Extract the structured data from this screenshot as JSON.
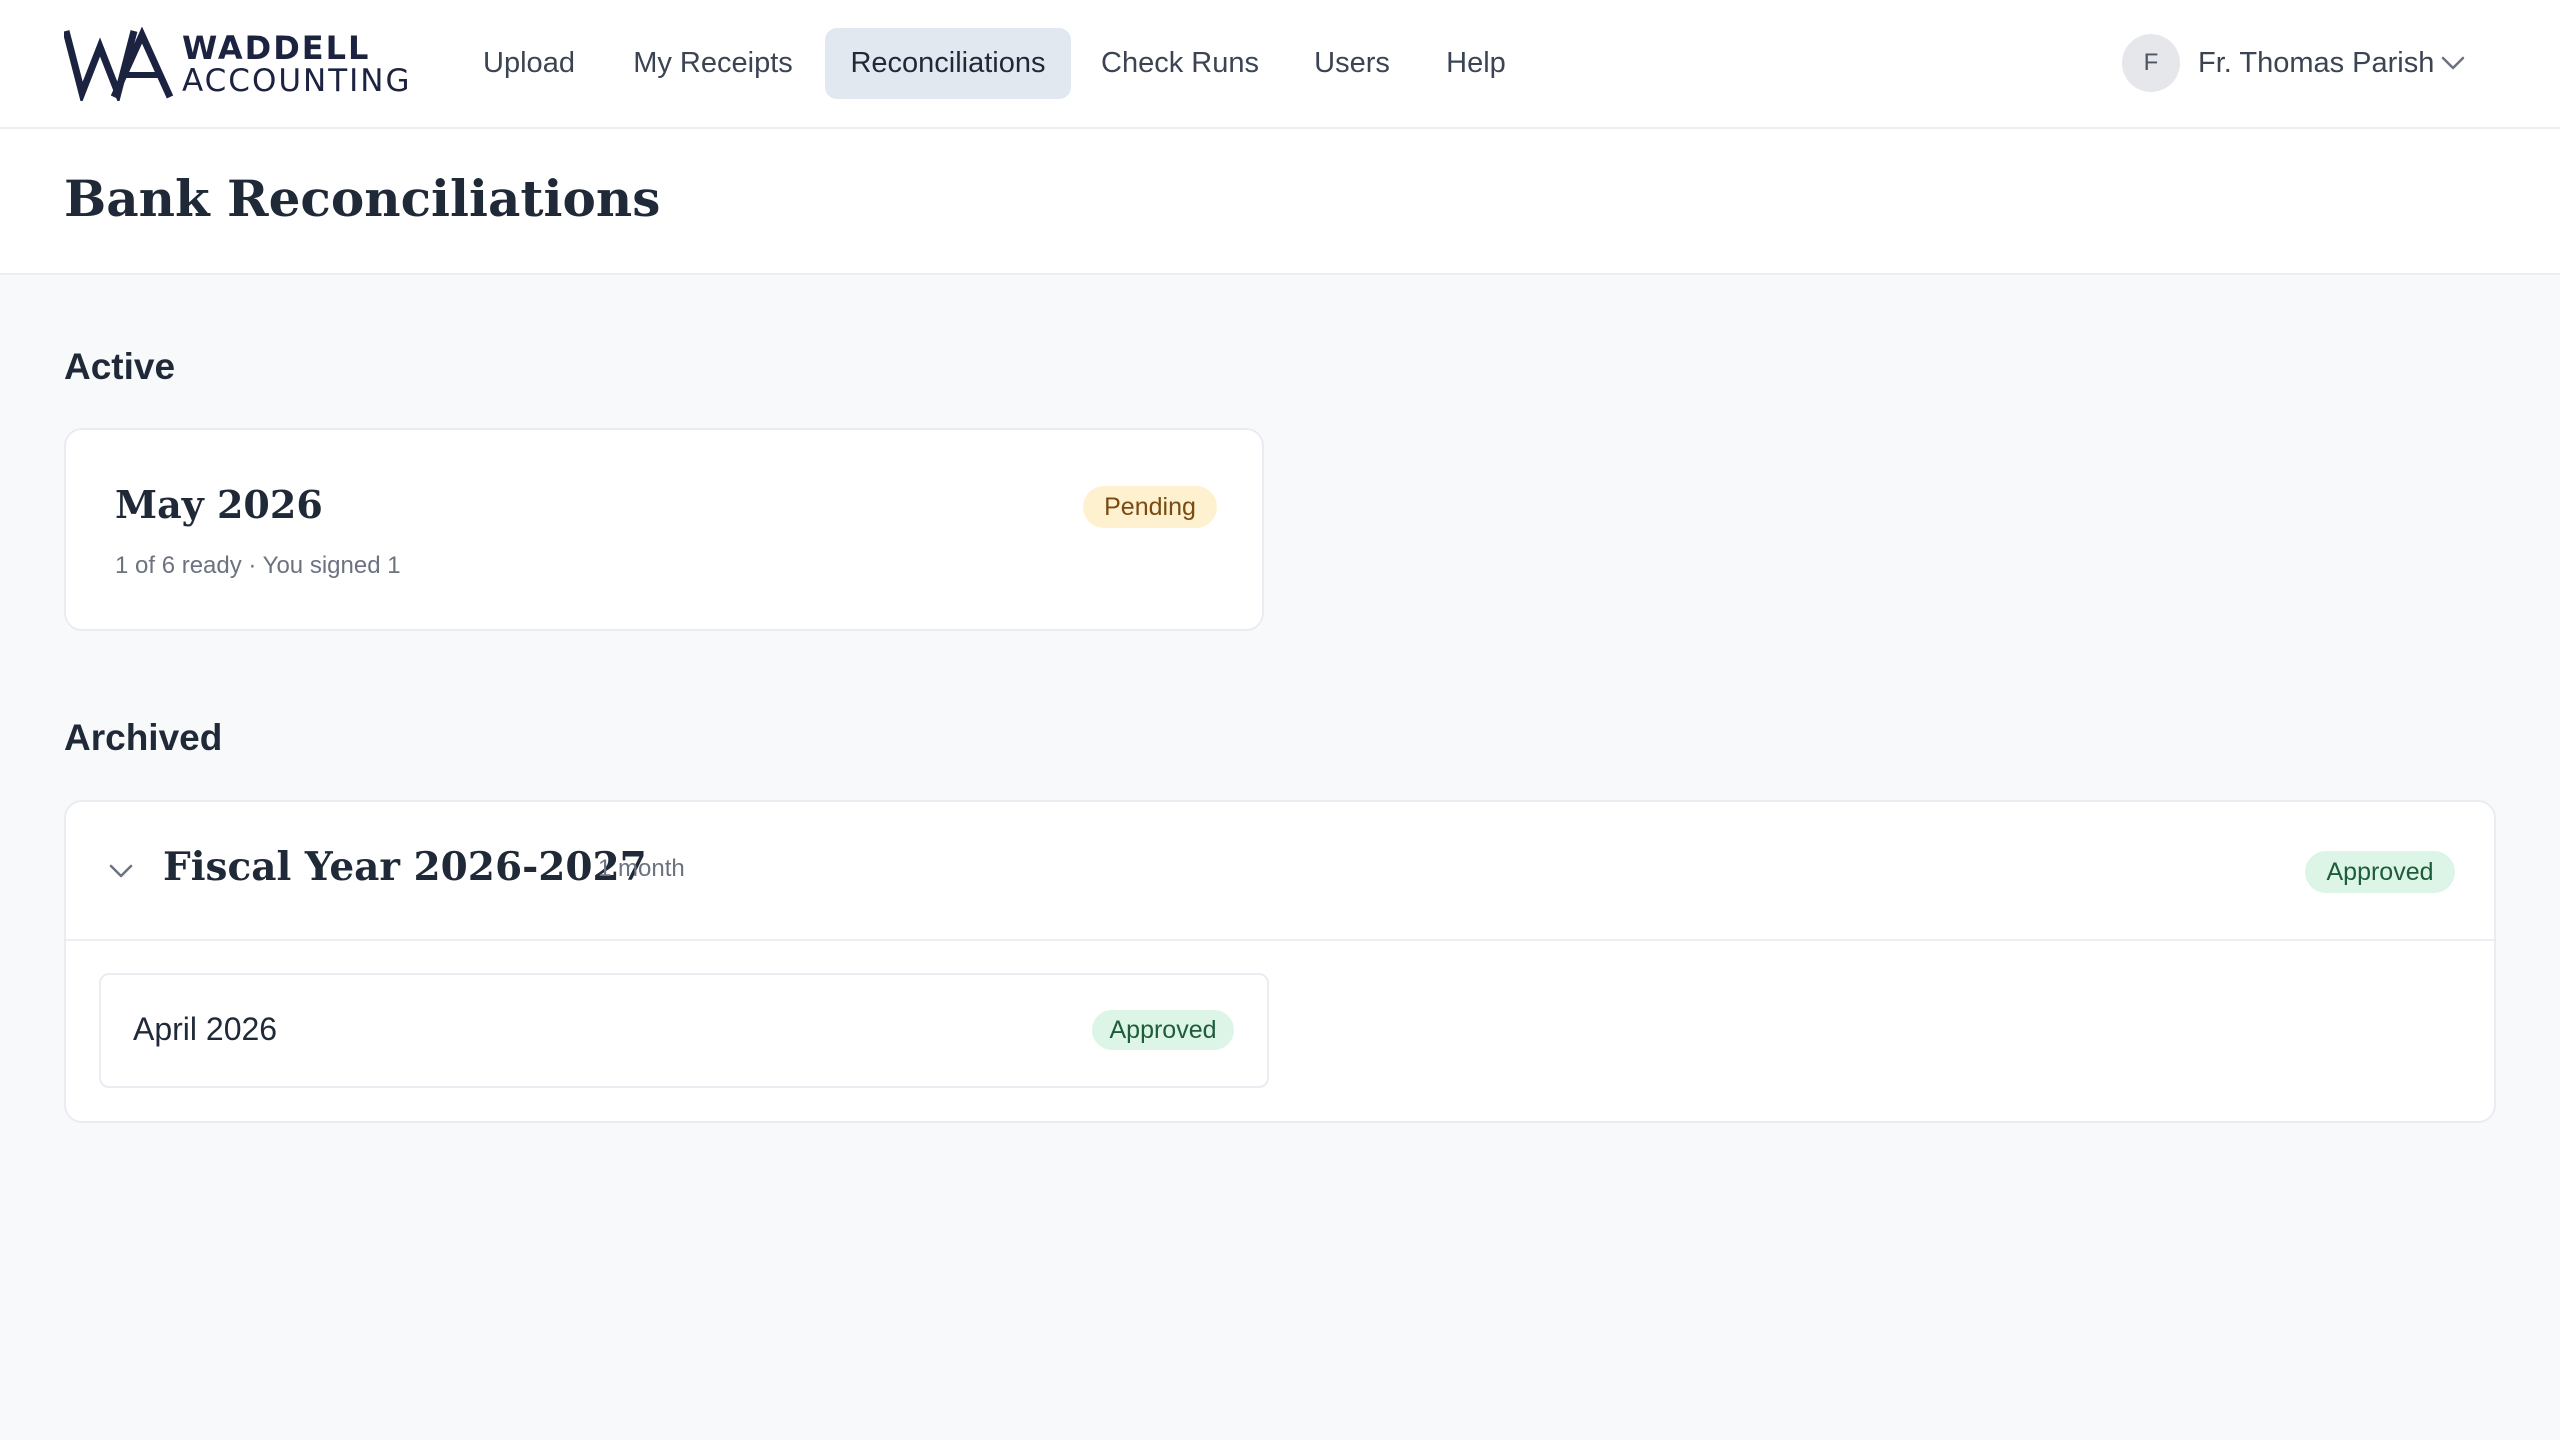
{
  "brand": {
    "monogram": "WA",
    "line1": "WADDELL",
    "line2": "ACCOUNTING"
  },
  "nav": {
    "items": [
      {
        "label": "Upload"
      },
      {
        "label": "My Receipts"
      },
      {
        "label": "Reconciliations",
        "active": true
      },
      {
        "label": "Check Runs"
      },
      {
        "label": "Users"
      },
      {
        "label": "Help"
      }
    ]
  },
  "user": {
    "initial": "F",
    "name": "Fr. Thomas Parish",
    "menu_icon": "chevron-down-icon"
  },
  "page": {
    "title": "Bank Reconciliations"
  },
  "active": {
    "heading": "Active",
    "cards": [
      {
        "title": "May 2026",
        "status": "Pending",
        "summary": "1 of 6 ready · You signed 1"
      }
    ]
  },
  "archived": {
    "heading": "Archived",
    "groups": [
      {
        "title": "Fiscal Year 2026-2027",
        "count": "1 month",
        "status": "Approved",
        "expanded": true,
        "toggle_icon": "chevron-down-icon",
        "months": [
          {
            "title": "April 2026",
            "status": "Approved"
          }
        ]
      }
    ]
  },
  "colors": {
    "brand_navy": "#1b2340",
    "active_tab_bg": "#e2e8ef",
    "pending_bg": "#fdf1cf",
    "pending_text": "#7a4a12",
    "approved_bg": "#dcf5e6",
    "approved_text": "#1e5c3a",
    "page_bg": "#f8f9fb"
  }
}
